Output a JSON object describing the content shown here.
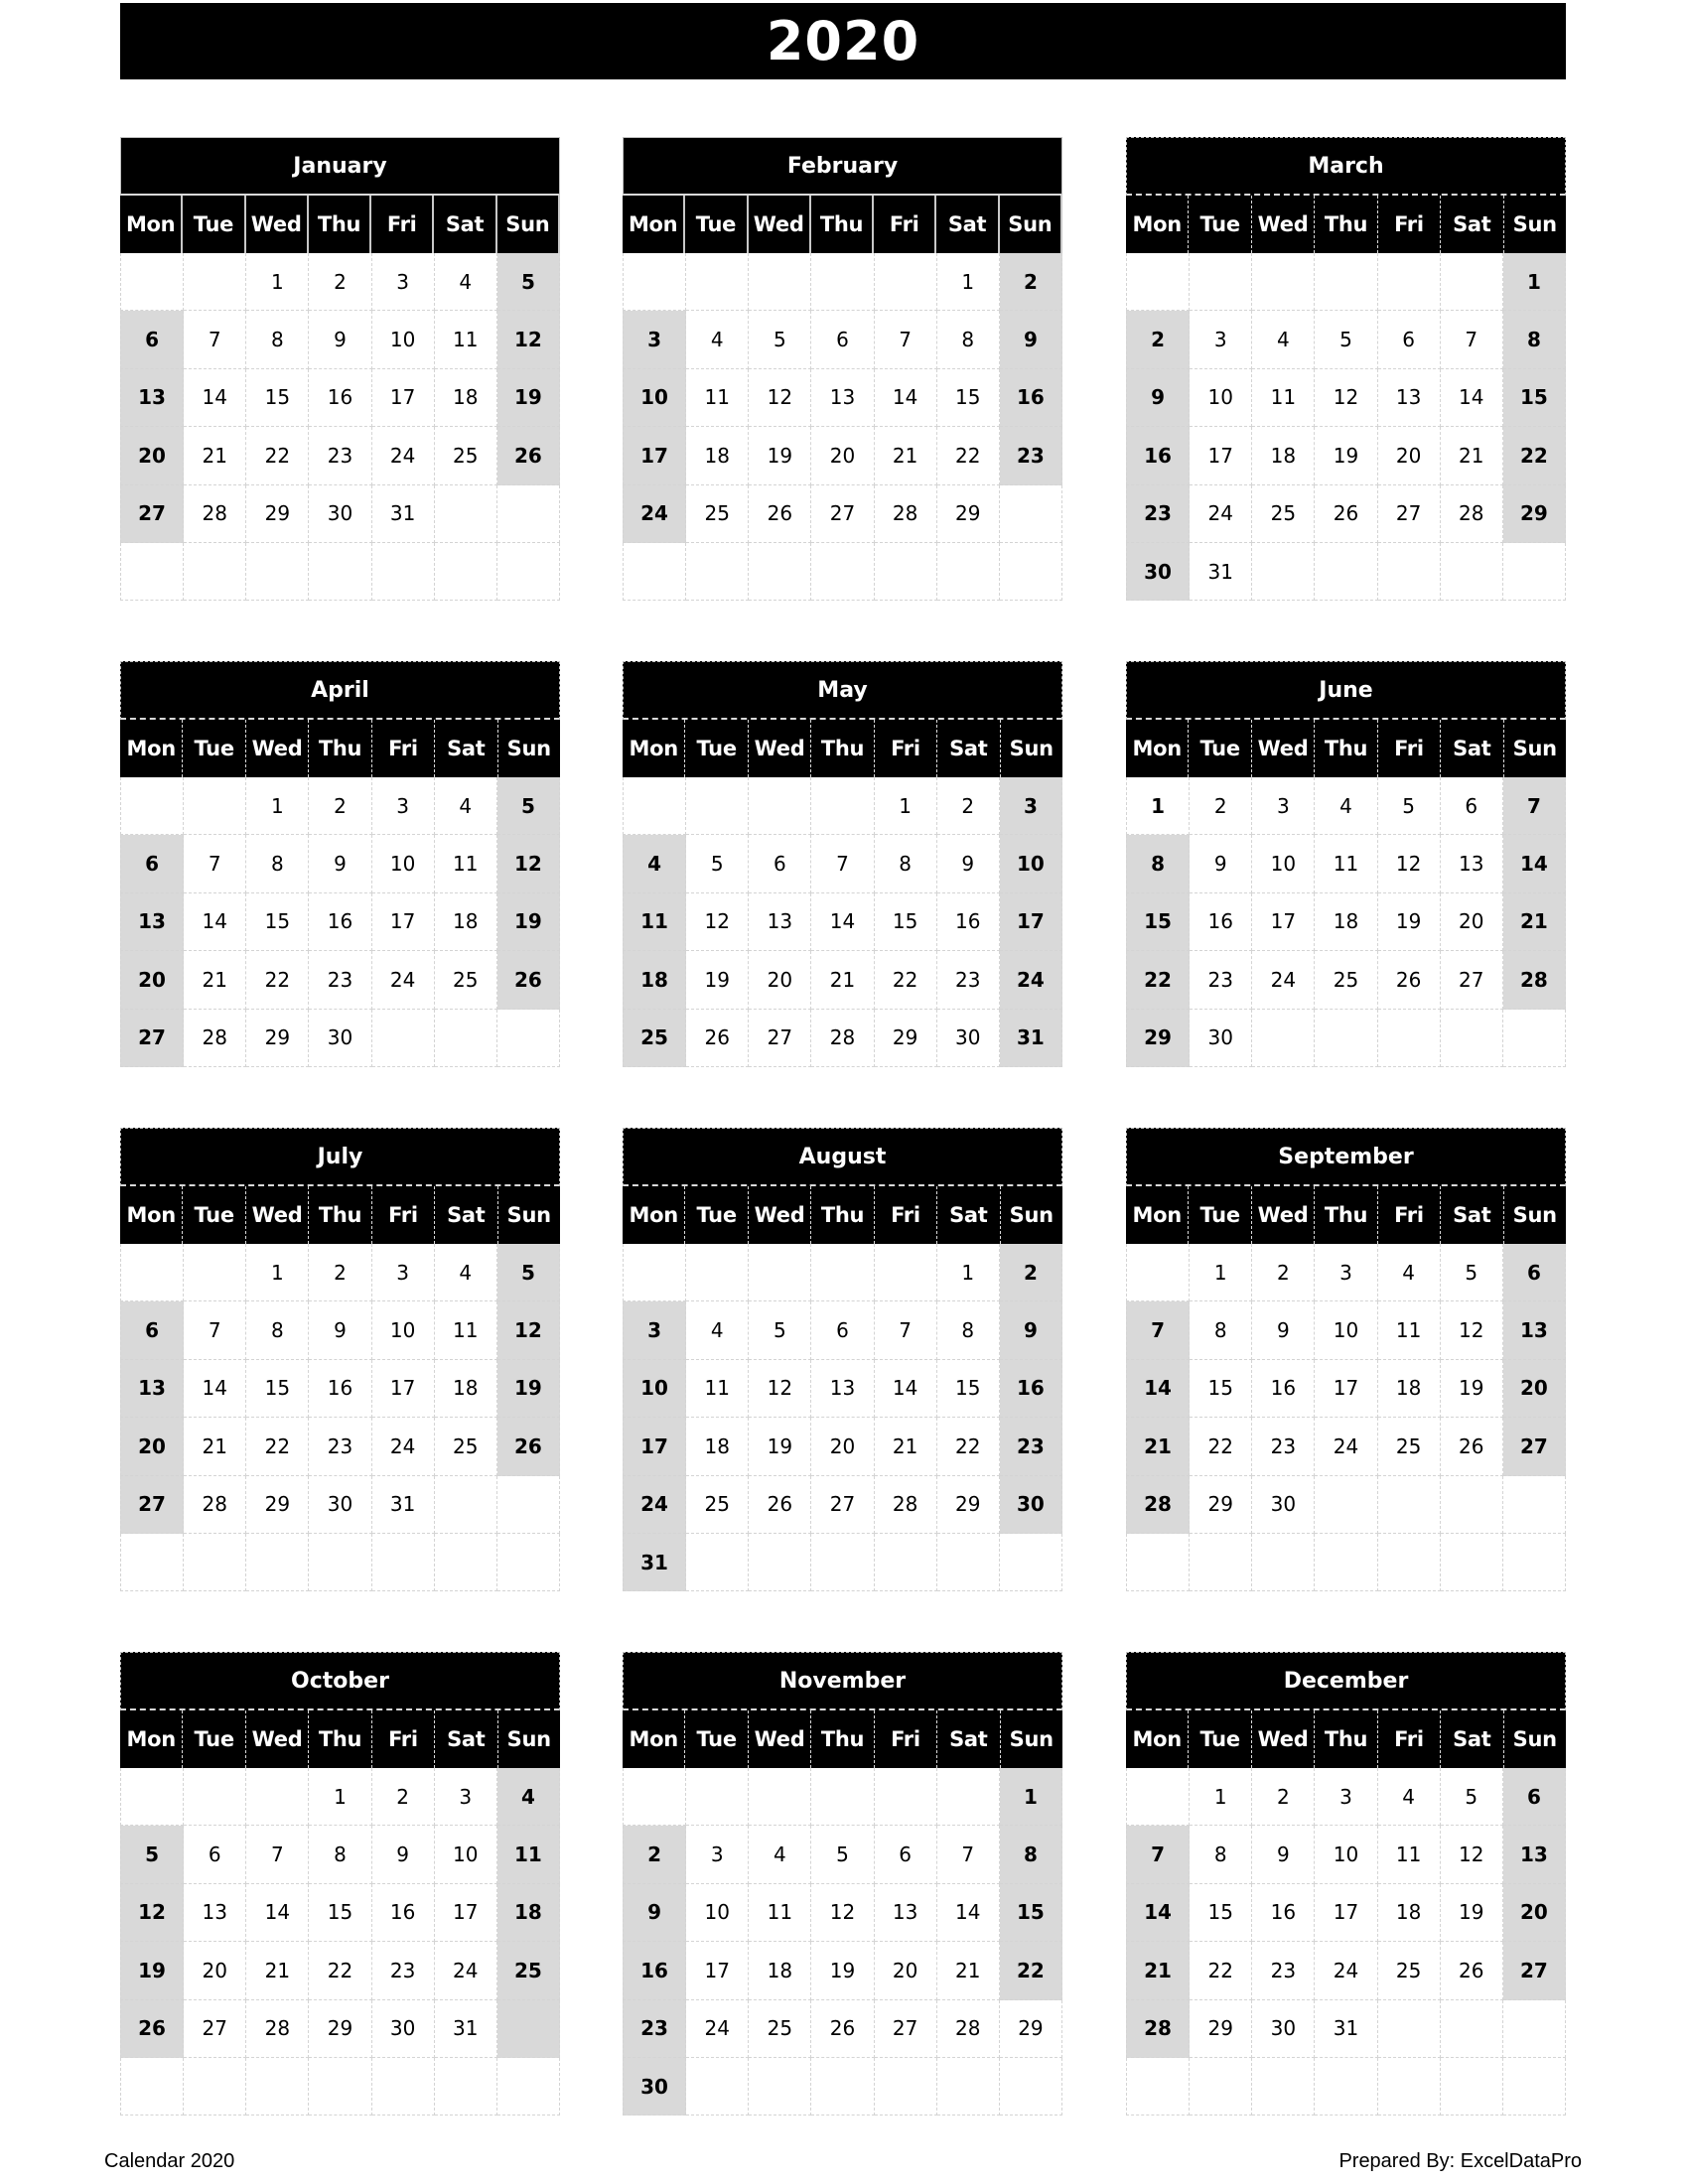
{
  "title": "2020",
  "weekdays": [
    "Mon",
    "Tue",
    "Wed",
    "Thu",
    "Fri",
    "Sat",
    "Sun"
  ],
  "colors": {
    "header_bg": "#000000",
    "header_text": "#ffffff",
    "weekend_shade": "#d9d9d9",
    "grid_line": "#d4d4d4"
  },
  "months": [
    {
      "name": "January",
      "weeks": [
        [
          "",
          "",
          "1",
          "2",
          "3",
          "4",
          "5"
        ],
        [
          "6",
          "7",
          "8",
          "9",
          "10",
          "11",
          "12"
        ],
        [
          "13",
          "14",
          "15",
          "16",
          "17",
          "18",
          "19"
        ],
        [
          "20",
          "21",
          "22",
          "23",
          "24",
          "25",
          "26"
        ],
        [
          "27",
          "28",
          "29",
          "30",
          "31",
          "",
          ""
        ],
        [
          "",
          "",
          "",
          "",
          "",
          "",
          ""
        ]
      ]
    },
    {
      "name": "February",
      "weeks": [
        [
          "",
          "",
          "",
          "",
          "",
          "1",
          "2"
        ],
        [
          "3",
          "4",
          "5",
          "6",
          "7",
          "8",
          "9"
        ],
        [
          "10",
          "11",
          "12",
          "13",
          "14",
          "15",
          "16"
        ],
        [
          "17",
          "18",
          "19",
          "20",
          "21",
          "22",
          "23"
        ],
        [
          "24",
          "25",
          "26",
          "27",
          "28",
          "29",
          ""
        ],
        [
          "",
          "",
          "",
          "",
          "",
          "",
          ""
        ]
      ]
    },
    {
      "name": "March",
      "weeks": [
        [
          "",
          "",
          "",
          "",
          "",
          "",
          "1"
        ],
        [
          "2",
          "3",
          "4",
          "5",
          "6",
          "7",
          "8"
        ],
        [
          "9",
          "10",
          "11",
          "12",
          "13",
          "14",
          "15"
        ],
        [
          "16",
          "17",
          "18",
          "19",
          "20",
          "21",
          "22"
        ],
        [
          "23",
          "24",
          "25",
          "26",
          "27",
          "28",
          "29"
        ],
        [
          "30",
          "31",
          "",
          "",
          "",
          "",
          ""
        ]
      ]
    },
    {
      "name": "April",
      "weeks": [
        [
          "",
          "",
          "1",
          "2",
          "3",
          "4",
          "5"
        ],
        [
          "6",
          "7",
          "8",
          "9",
          "10",
          "11",
          "12"
        ],
        [
          "13",
          "14",
          "15",
          "16",
          "17",
          "18",
          "19"
        ],
        [
          "20",
          "21",
          "22",
          "23",
          "24",
          "25",
          "26"
        ],
        [
          "27",
          "28",
          "29",
          "30",
          "",
          "",
          ""
        ]
      ]
    },
    {
      "name": "May",
      "weeks": [
        [
          "",
          "",
          "",
          "",
          "1",
          "2",
          "3"
        ],
        [
          "4",
          "5",
          "6",
          "7",
          "8",
          "9",
          "10"
        ],
        [
          "11",
          "12",
          "13",
          "14",
          "15",
          "16",
          "17"
        ],
        [
          "18",
          "19",
          "20",
          "21",
          "22",
          "23",
          "24"
        ],
        [
          "25",
          "26",
          "27",
          "28",
          "29",
          "30",
          "31"
        ]
      ]
    },
    {
      "name": "June",
      "weeks": [
        [
          "1",
          "2",
          "3",
          "4",
          "5",
          "6",
          "7"
        ],
        [
          "8",
          "9",
          "10",
          "11",
          "12",
          "13",
          "14"
        ],
        [
          "15",
          "16",
          "17",
          "18",
          "19",
          "20",
          "21"
        ],
        [
          "22",
          "23",
          "24",
          "25",
          "26",
          "27",
          "28"
        ],
        [
          "29",
          "30",
          "",
          "",
          "",
          "",
          ""
        ]
      ],
      "unshaded": [
        [
          0,
          0
        ]
      ]
    },
    {
      "name": "July",
      "weeks": [
        [
          "",
          "",
          "1",
          "2",
          "3",
          "4",
          "5"
        ],
        [
          "6",
          "7",
          "8",
          "9",
          "10",
          "11",
          "12"
        ],
        [
          "13",
          "14",
          "15",
          "16",
          "17",
          "18",
          "19"
        ],
        [
          "20",
          "21",
          "22",
          "23",
          "24",
          "25",
          "26"
        ],
        [
          "27",
          "28",
          "29",
          "30",
          "31",
          "",
          ""
        ],
        [
          "",
          "",
          "",
          "",
          "",
          "",
          ""
        ]
      ]
    },
    {
      "name": "August",
      "weeks": [
        [
          "",
          "",
          "",
          "",
          "",
          "1",
          "2"
        ],
        [
          "3",
          "4",
          "5",
          "6",
          "7",
          "8",
          "9"
        ],
        [
          "10",
          "11",
          "12",
          "13",
          "14",
          "15",
          "16"
        ],
        [
          "17",
          "18",
          "19",
          "20",
          "21",
          "22",
          "23"
        ],
        [
          "24",
          "25",
          "26",
          "27",
          "28",
          "29",
          "30"
        ],
        [
          "31",
          "",
          "",
          "",
          "",
          "",
          ""
        ]
      ]
    },
    {
      "name": "September",
      "weeks": [
        [
          "",
          "1",
          "2",
          "3",
          "4",
          "5",
          "6"
        ],
        [
          "7",
          "8",
          "9",
          "10",
          "11",
          "12",
          "13"
        ],
        [
          "14",
          "15",
          "16",
          "17",
          "18",
          "19",
          "20"
        ],
        [
          "21",
          "22",
          "23",
          "24",
          "25",
          "26",
          "27"
        ],
        [
          "28",
          "29",
          "30",
          "",
          "",
          "",
          ""
        ],
        [
          "",
          "",
          "",
          "",
          "",
          "",
          ""
        ]
      ]
    },
    {
      "name": "October",
      "weeks": [
        [
          "",
          "",
          "",
          "1",
          "2",
          "3",
          "4"
        ],
        [
          "5",
          "6",
          "7",
          "8",
          "9",
          "10",
          "11"
        ],
        [
          "12",
          "13",
          "14",
          "15",
          "16",
          "17",
          "18"
        ],
        [
          "19",
          "20",
          "21",
          "22",
          "23",
          "24",
          "25"
        ],
        [
          "26",
          "27",
          "28",
          "29",
          "30",
          "31",
          ""
        ],
        [
          "",
          "",
          "",
          "",
          "",
          "",
          ""
        ]
      ],
      "extra_shaded": [
        [
          4,
          6
        ]
      ]
    },
    {
      "name": "November",
      "weeks": [
        [
          "",
          "",
          "",
          "",
          "",
          "",
          "1"
        ],
        [
          "2",
          "3",
          "4",
          "5",
          "6",
          "7",
          "8"
        ],
        [
          "9",
          "10",
          "11",
          "12",
          "13",
          "14",
          "15"
        ],
        [
          "16",
          "17",
          "18",
          "19",
          "20",
          "21",
          "22"
        ],
        [
          "23",
          "24",
          "25",
          "26",
          "27",
          "28",
          "29"
        ],
        [
          "30",
          "",
          "",
          "",
          "",
          "",
          ""
        ]
      ],
      "unshaded": [
        [
          4,
          6
        ]
      ],
      "not_bold": [
        [
          4,
          6
        ]
      ]
    },
    {
      "name": "December",
      "weeks": [
        [
          "",
          "1",
          "2",
          "3",
          "4",
          "5",
          "6"
        ],
        [
          "7",
          "8",
          "9",
          "10",
          "11",
          "12",
          "13"
        ],
        [
          "14",
          "15",
          "16",
          "17",
          "18",
          "19",
          "20"
        ],
        [
          "21",
          "22",
          "23",
          "24",
          "25",
          "26",
          "27"
        ],
        [
          "28",
          "29",
          "30",
          "31",
          "",
          "",
          ""
        ],
        [
          "",
          "",
          "",
          "",
          "",
          "",
          ""
        ]
      ]
    }
  ],
  "footer": {
    "left": "Calendar 2020",
    "right": "Prepared By: ExcelDataPro"
  }
}
